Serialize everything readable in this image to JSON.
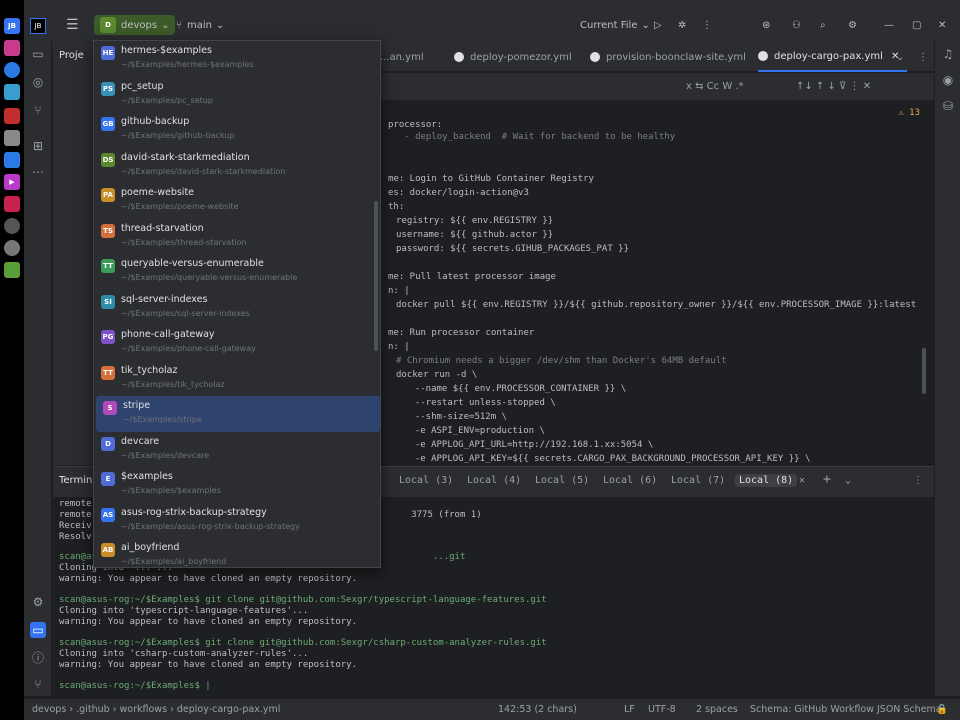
{
  "titlebar": {
    "project_label": "devops",
    "project_badge": "D",
    "branch_label": "main",
    "run_config": "Current File"
  },
  "tabs": [
    {
      "label": "...an.yml"
    },
    {
      "label": "deploy-pomezor.yml"
    },
    {
      "label": "provision-boonclaw-site.yml"
    },
    {
      "label": "deploy-cargo-pax.yml"
    }
  ],
  "editor": {
    "lines": [
      {
        "t": "processor:"
      },
      {
        "t": "   - deploy_backend  # Wait for backend to be healthy"
      },
      {
        "t": ""
      },
      {
        "t": ""
      },
      {
        "t": "me: Login to GitHub Container Registry"
      },
      {
        "t": "es: docker/login-action@v3"
      },
      {
        "t": "th:"
      },
      {
        "t": "registry: ${{ env.REGISTRY }}"
      },
      {
        "t": "username: ${{ github.actor }}"
      },
      {
        "t": "password: ${{ secrets.GIHUB_PACKAGES_PAT }}"
      },
      {
        "t": ""
      },
      {
        "t": "me: Pull latest processor image"
      },
      {
        "t": "n: |"
      },
      {
        "t": "docker pull ${{ env.REGISTRY }}/${{ github.repository_owner }}/${{ env.PROCESSOR_IMAGE }}:latest"
      },
      {
        "t": ""
      },
      {
        "t": "me: Run processor container"
      },
      {
        "t": "n: |"
      },
      {
        "t": "# Chromium needs a bigger /dev/shm than Docker's 64MB default"
      },
      {
        "t": "docker run -d \\"
      },
      {
        "t": "  --name ${{ env.PROCESSOR_CONTAINER }} \\"
      },
      {
        "t": "  --restart unless-stopped \\"
      },
      {
        "t": "  --shm-size=512m \\"
      },
      {
        "t": "  -e ASPI_ENV=production \\"
      },
      {
        "t": "  -e APPLOG_API_URL=http://192.168.1.xx:5054 \\"
      },
      {
        "t": "  -e APPLOG_API_KEY=${{ secrets.CARGO_PAX_BACKGROUND_PROCESSOR_API_KEY }} \\"
      }
    ]
  },
  "terminal": {
    "title": "Terminal",
    "tabs": [
      "Local (3)",
      "Local (4)",
      "Local (5)",
      "Local (6)",
      "Local (7)",
      "Local (8)"
    ],
    "lines": [
      "remote: ...",
      "remote: ...                                                      3775 (from 1)",
      "Receiv...",
      "Resolv...",
      "scan@asus-rog:~/$Examples$ git clone ...                             ...git",
      "Cloning into '...'...",
      "warning: You appear to have cloned an empty repository.",
      "scan@asus-rog:~/$Examples$ git clone git@github.com:Sexgr/typescript-language-features.git",
      "Cloning into 'typescript-language-features'...",
      "warning: You appear to have cloned an empty repository.",
      "scan@asus-rog:~/$Examples$ git clone git@github.com:Sexgr/csharp-custom-analyzer-rules.git",
      "Cloning into 'csharp-custom-analyzer-rules'...",
      "warning: You appear to have cloned an empty repository.",
      "",
      "scan@asus-rog:~/$Examples$ |"
    ]
  },
  "statusbar": {
    "breadcrumb": [
      "devops",
      ".github",
      "workflows",
      "deploy-cargo-pax.yml"
    ],
    "position": "142:53 (2 chars)",
    "line_ending": "LF",
    "encoding": "UTF-8",
    "indent": "2 spaces",
    "schema": "Schema: GitHub Workflow JSON Schema"
  },
  "projects": [
    {
      "badge": "HE",
      "color": "#4f6bd6",
      "name": "hermes-$examples",
      "path": "~/$Examples/hermes-$examples"
    },
    {
      "badge": "PS",
      "color": "#3a8fb7",
      "name": "pc_setup",
      "path": "~/$Examples/pc_setup"
    },
    {
      "badge": "GB",
      "color": "#3574f0",
      "name": "github-backup",
      "path": "~/$Examples/github-backup"
    },
    {
      "badge": "DS",
      "color": "#5b8a2e",
      "name": "david-stark-starkmediation",
      "path": "~/$Examples/david-stark-starkmediation"
    },
    {
      "badge": "PA",
      "color": "#c98d2a",
      "name": "poeme-website",
      "path": "~/$Examples/poeme-website"
    },
    {
      "badge": "TS",
      "color": "#d4703c",
      "name": "thread-starvation",
      "path": "~/$Examples/thread-starvation"
    },
    {
      "badge": "TT",
      "color": "#3b9c5a",
      "name": "queryable-versus-enumerable",
      "path": "~/$Examples/queryable-versus-enumerable"
    },
    {
      "badge": "SI",
      "color": "#2e8ca8",
      "name": "sql-server-indexes",
      "path": "~/$Examples/sql-server-indexes"
    },
    {
      "badge": "PG",
      "color": "#7d52c7",
      "name": "phone-call-gateway",
      "path": "~/$Examples/phone-call-gateway"
    },
    {
      "badge": "TT",
      "color": "#d4703c",
      "name": "tik_tycholaz",
      "path": "~/$Examples/tik_tycholaz"
    },
    {
      "badge": "S",
      "color": "#b14ab8",
      "name": "stripe",
      "path": "~/$Examples/stripe"
    },
    {
      "badge": "D",
      "color": "#4f6bd6",
      "name": "devcare",
      "path": "~/$Examples/devcare"
    },
    {
      "badge": "E",
      "color": "#4f6bd6",
      "name": "$examples",
      "path": "~/$Examples/$examples"
    },
    {
      "badge": "AS",
      "color": "#3574f0",
      "name": "asus-rog-strix-backup-strategy",
      "path": "~/$Examples/asus-rog-strix-backup-strategy"
    },
    {
      "badge": "AB",
      "color": "#c98d2a",
      "name": "ai_boyfriend",
      "path": "~/$Examples/ai_boyfriend"
    }
  ]
}
